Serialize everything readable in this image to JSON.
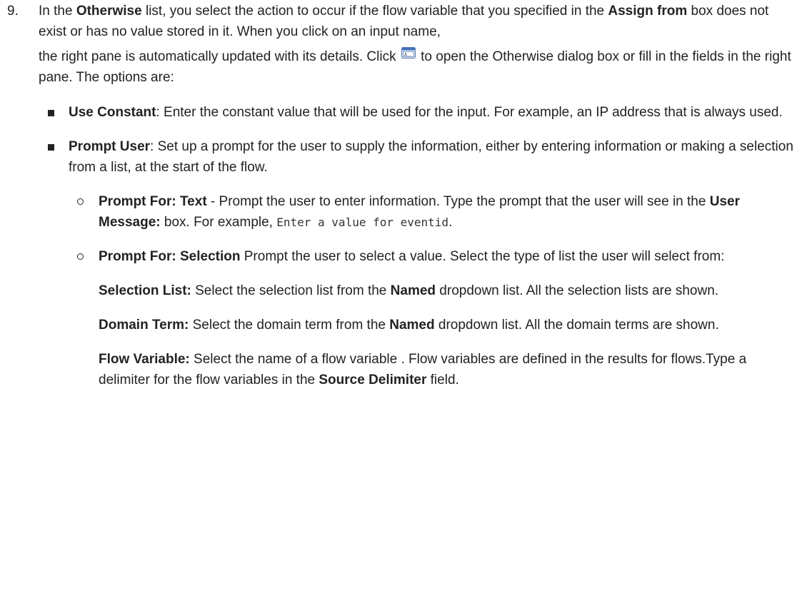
{
  "step": {
    "number": "9.",
    "intro": {
      "t1": "In the ",
      "b1": "Otherwise",
      "t2": " list, you select the action to occur if the flow variable that you specified in the ",
      "b2": "Assign from",
      "t3": " box does not exist or has no value stored in it. When you click on an input name,",
      "t4": "the right pane is automatically updated with its details. Click ",
      "t5": " to open the Otherwise dialog box or fill in the fields in the right pane. The options are:"
    },
    "icon": "input-dialog-icon"
  },
  "options": {
    "use_constant": {
      "label": "Use Constant",
      "text": ": Enter the constant value that will be used for the input. For example, an IP address that is always used."
    },
    "prompt_user": {
      "label": "Prompt User",
      "text": ": Set up a prompt for the user to supply the information, either by entering information or making a selection from a list, at the start of the flow."
    }
  },
  "prompt_text": {
    "label": "Prompt For: Text",
    "t1": " - Prompt the user to enter information. Type the prompt that the user will see in the ",
    "b1": "User Message:",
    "t2": " box. For example, ",
    "code": "Enter a value for eventid",
    "t3": "."
  },
  "prompt_selection": {
    "label": "Prompt For: Selection",
    "t1": " Prompt the user to select a value. Select the type of list the user will select from:",
    "selection_list": {
      "label": "Selection List:",
      "t1": " Select the selection list from the ",
      "b1": "Named",
      "t2": " dropdown list. All the selection lists are shown."
    },
    "domain_term": {
      "label": "Domain Term:",
      "t1": " Select the domain term from the ",
      "b1": "Named",
      "t2": " dropdown list. All the domain terms are shown."
    },
    "flow_variable": {
      "label": "Flow Variable:",
      "t1": " Select the name of a flow variable . Flow variables are defined in the results for flows.Type a delimiter for the flow variables in the ",
      "b1": "Source Delimiter",
      "t2": " field."
    }
  }
}
